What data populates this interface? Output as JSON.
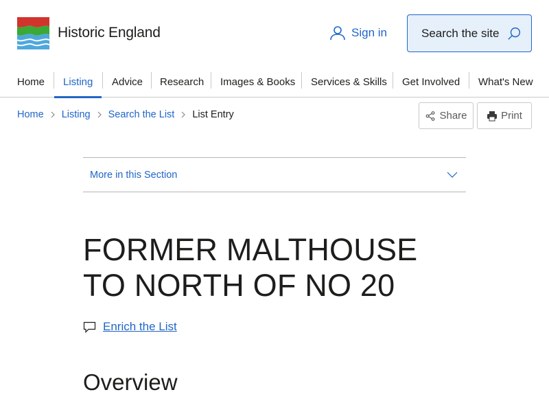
{
  "header": {
    "logo_text": "Historic England",
    "sign_in_label": "Sign in",
    "search_label": "Search the site",
    "colors": {
      "brand_blue": "#2066c7",
      "logo_red": "#d0342c",
      "logo_green": "#3aa935",
      "logo_blue": "#4ea8dc"
    }
  },
  "nav": {
    "items": [
      {
        "label": "Home"
      },
      {
        "label": "Listing",
        "active": true
      },
      {
        "label": "Advice"
      },
      {
        "label": "Research"
      },
      {
        "label": "Images & Books"
      },
      {
        "label": "Services & Skills"
      },
      {
        "label": "Get Involved"
      },
      {
        "label": "What's New"
      }
    ]
  },
  "breadcrumb": {
    "items": [
      {
        "label": "Home"
      },
      {
        "label": "Listing"
      },
      {
        "label": "Search the List"
      },
      {
        "label": "List Entry"
      }
    ]
  },
  "tools": {
    "share_label": "Share",
    "print_label": "Print"
  },
  "section_menu": {
    "label": "More in this Section"
  },
  "entry": {
    "title": "FORMER MALTHOUSE TO NORTH OF NO 20",
    "enrich_label": "Enrich the List",
    "overview_heading": "Overview"
  },
  "icons": {
    "search": "search-icon",
    "user": "user-icon",
    "share": "share-icon",
    "print": "printer-icon",
    "comment": "comment-icon",
    "chevron": "chevron-down-icon"
  }
}
